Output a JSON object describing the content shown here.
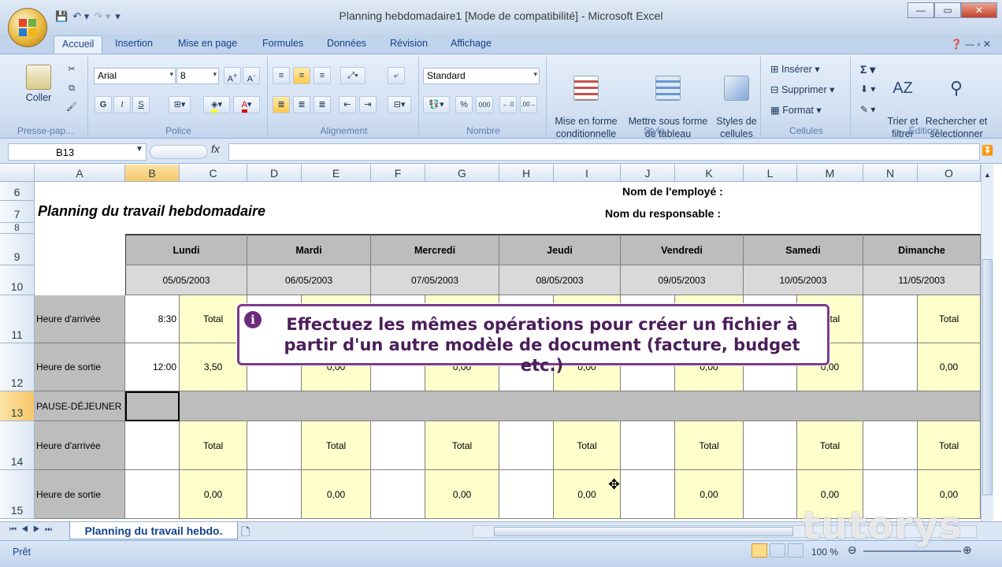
{
  "window": {
    "title": "Planning hebdomadaire1  [Mode de compatibilité] - Microsoft Excel"
  },
  "tabs": [
    "Accueil",
    "Insertion",
    "Mise en page",
    "Formules",
    "Données",
    "Révision",
    "Affichage"
  ],
  "ribbon": {
    "clipboard": {
      "paste": "Coller",
      "label": "Presse-pap..."
    },
    "font": {
      "name": "Arial",
      "size": "8",
      "bold": "G",
      "italic": "I",
      "underline": "S",
      "label": "Police"
    },
    "alignment": {
      "label": "Alignement"
    },
    "number": {
      "format": "Standard",
      "percent": "%",
      "thousands": "000",
      "label": "Nombre"
    },
    "style": {
      "cond_format": "Mise en forme\nconditionnelle",
      "table_format": "Mettre sous forme\nde tableau",
      "cell_styles": "Styles de\ncellules",
      "label": "Style"
    },
    "cells": {
      "insert": "Insérer",
      "delete": "Supprimer",
      "format": "Format",
      "label": "Cellules"
    },
    "editing": {
      "sum": "Σ",
      "sort": "Trier et\nfiltrer",
      "find": "Rechercher et\nsélectionner",
      "label": "Édition"
    }
  },
  "formula_bar": {
    "name_box": "B13",
    "fx": "fx",
    "formula": ""
  },
  "columns": [
    "A",
    "B",
    "C",
    "D",
    "E",
    "F",
    "G",
    "H",
    "I",
    "J",
    "K",
    "L",
    "M",
    "N",
    "O"
  ],
  "rows": [
    "6",
    "7",
    "8",
    "9",
    "10",
    "11",
    "12",
    "13",
    "14",
    "15"
  ],
  "sheet": {
    "title": "Planning du travail hebdomadaire",
    "employee_label": "Nom de l'employé :",
    "manager_label": "Nom du responsable :",
    "days": [
      "Lundi",
      "Mardi",
      "Mercredi",
      "Jeudi",
      "Vendredi",
      "Samedi",
      "Dimanche"
    ],
    "dates": [
      "05/05/2003",
      "06/05/2003",
      "07/05/2003",
      "08/05/2003",
      "09/05/2003",
      "10/05/2003",
      "11/05/2003"
    ],
    "arrival_label": "Heure d'arrivée",
    "departure_label": "Heure de sortie",
    "lunch_label": "PAUSE-DÉJEUNER",
    "total_label": "Total",
    "row11_time": "8:30",
    "row12_time": "12:00",
    "row12_total": "3,50",
    "zero": "0,00"
  },
  "overlay": {
    "info_icon": "i",
    "text": "Effectuez les mêmes opérations pour créer un fichier à partir d'un autre modèle de document (facture, budget etc.)"
  },
  "sheet_tab": {
    "name": "Planning du travail hebdo."
  },
  "status": {
    "ready": "Prêt",
    "zoom": "100 %"
  },
  "watermark": "tutorys"
}
